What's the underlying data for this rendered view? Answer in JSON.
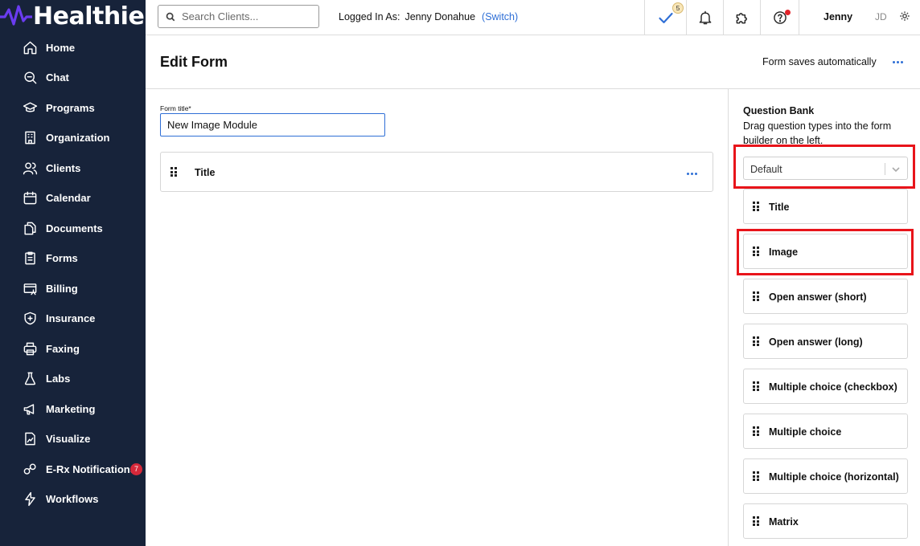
{
  "app": {
    "brand": "Healthie",
    "accent_color": "#2f6fd6",
    "sidebar_color": "#17233a",
    "highlight_color": "#e8141a"
  },
  "sidebar": {
    "items": [
      {
        "label": "Home",
        "icon": "home-icon"
      },
      {
        "label": "Chat",
        "icon": "chat-icon"
      },
      {
        "label": "Programs",
        "icon": "graduation-cap-icon"
      },
      {
        "label": "Organization",
        "icon": "building-icon"
      },
      {
        "label": "Clients",
        "icon": "users-icon"
      },
      {
        "label": "Calendar",
        "icon": "calendar-icon"
      },
      {
        "label": "Documents",
        "icon": "documents-icon"
      },
      {
        "label": "Forms",
        "icon": "clipboard-icon"
      },
      {
        "label": "Billing",
        "icon": "billing-icon"
      },
      {
        "label": "Insurance",
        "icon": "shield-icon"
      },
      {
        "label": "Faxing",
        "icon": "printer-icon"
      },
      {
        "label": "Labs",
        "icon": "flask-icon"
      },
      {
        "label": "Marketing",
        "icon": "megaphone-icon"
      },
      {
        "label": "Visualize",
        "icon": "chart-icon"
      },
      {
        "label": "E-Rx Notifications",
        "icon": "pill-icon",
        "badge": "7"
      },
      {
        "label": "Workflows",
        "icon": "lightning-icon"
      }
    ]
  },
  "topbar": {
    "search_placeholder": "Search Clients...",
    "logged_in_label": "Logged In As:",
    "logged_in_user": "Jenny Donahue",
    "switch_label": "(Switch)",
    "tasks_count": "5",
    "user_first_name": "Jenny",
    "user_initials": "JD"
  },
  "header": {
    "title": "Edit Form",
    "autosave_text": "Form saves automatically"
  },
  "builder": {
    "form_title_label": "Form title*",
    "form_title_value": "New Image Module",
    "blocks": [
      {
        "label": "Title"
      }
    ]
  },
  "question_bank": {
    "title": "Question Bank",
    "description": "Drag question types into the form builder on the left.",
    "selected_set": "Default",
    "items": [
      {
        "label": "Title"
      },
      {
        "label": "Image"
      },
      {
        "label": "Open answer (short)"
      },
      {
        "label": "Open answer (long)"
      },
      {
        "label": "Multiple choice (checkbox)"
      },
      {
        "label": "Multiple choice"
      },
      {
        "label": "Multiple choice (horizontal)"
      },
      {
        "label": "Matrix"
      }
    ]
  }
}
